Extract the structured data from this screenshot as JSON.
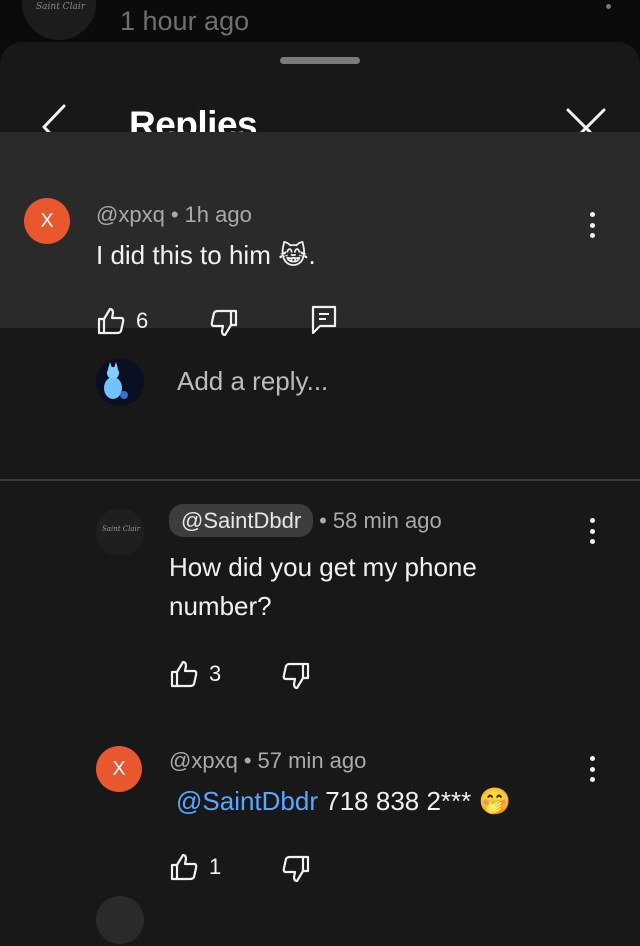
{
  "background": {
    "timestamp": "1 hour ago",
    "avatar_signature": "Saint Clair"
  },
  "header": {
    "title": "Replies"
  },
  "top_comment": {
    "avatar_letter": "X",
    "handle": "@xpxq",
    "separator": "•",
    "time": "1h ago",
    "text": "I did this to him",
    "text_end": ".",
    "emoji": "😹",
    "likes": "6"
  },
  "reply_box": {
    "placeholder": "Add a reply..."
  },
  "replies": [
    {
      "avatar_signature": "Saint Clair",
      "handle": "@SaintDbdr",
      "separator": "•",
      "time": "58 min ago",
      "text": "How did you get my phone number?",
      "likes": "3"
    },
    {
      "avatar_letter": "X",
      "handle": "@xpxq",
      "separator": "•",
      "time": "57 min ago",
      "mention": "@SaintDbdr",
      "text": "718 838 2***",
      "emoji": "🤭",
      "likes": "1"
    }
  ],
  "colors": {
    "sheet": "#181818",
    "highlight": "#2a2a2a",
    "avatar_x": "#e9572f",
    "mention": "#5aa7ff"
  }
}
